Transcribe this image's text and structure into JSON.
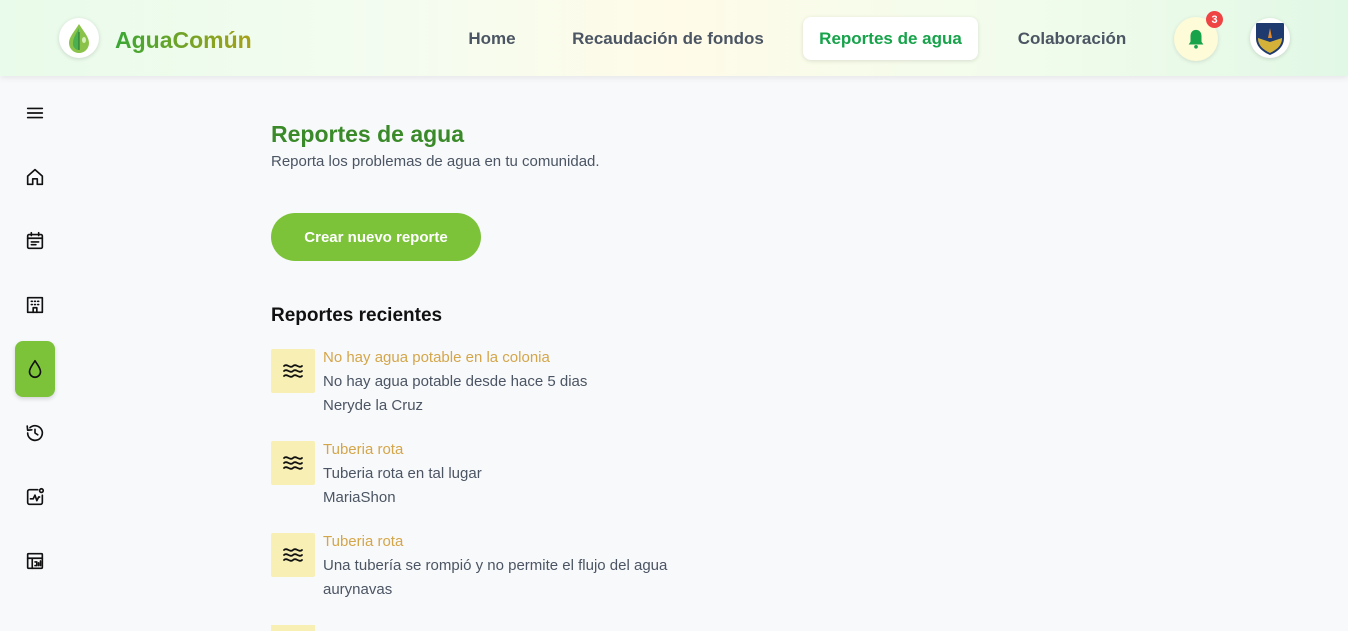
{
  "header": {
    "brand": "AguaComún",
    "nav": {
      "home": "Home",
      "fondos": "Recaudación de fondos",
      "reportes": "Reportes de agua",
      "colaboracion": "Colaboración"
    },
    "notification_count": "3"
  },
  "sidebar": {
    "items": [
      {
        "icon": "menu-icon"
      },
      {
        "icon": "home-icon"
      },
      {
        "icon": "calendar-icon"
      },
      {
        "icon": "building-icon"
      },
      {
        "icon": "water-drop-icon",
        "active": true
      },
      {
        "icon": "history-icon"
      },
      {
        "icon": "activity-icon"
      },
      {
        "icon": "report-chart-icon"
      }
    ]
  },
  "main": {
    "title": "Reportes de agua",
    "subtitle": "Reporta los problemas de agua en tu comunidad.",
    "create_button": "Crear nuevo reporte",
    "recent_title": "Reportes recientes",
    "reports": [
      {
        "title": "No hay agua potable en la colonia",
        "description": "No hay agua potable desde hace 5 dias",
        "author": "Neryde la Cruz"
      },
      {
        "title": "Tuberia rota",
        "description": "Tuberia rota en tal lugar",
        "author": "MariaShon"
      },
      {
        "title": "Tuberia rota",
        "description": "Una tubería se rompió y no permite el flujo del agua",
        "author": "aurynavas"
      }
    ]
  },
  "colors": {
    "accent_green": "#7cc33a",
    "title_green": "#3a8a2a",
    "report_title": "#d4a64a",
    "icon_bg": "#f7efb3"
  }
}
